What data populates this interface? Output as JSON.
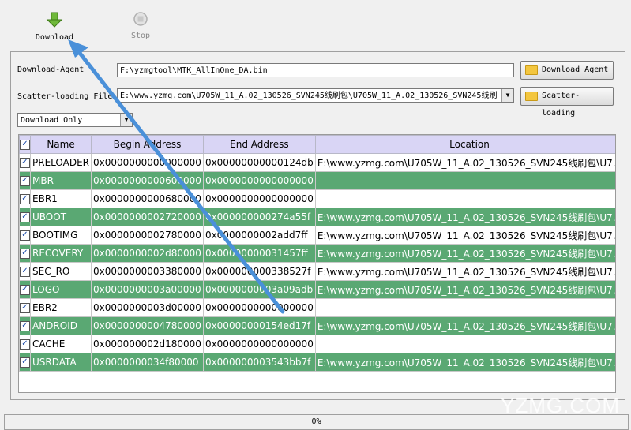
{
  "toolbar": {
    "download_label": "Download",
    "stop_label": "Stop"
  },
  "form": {
    "download_agent_label": "Download-Agent",
    "download_agent_value": "F:\\yzmgtool\\MTK_AllInOne_DA.bin",
    "download_agent_button": "Download Agent",
    "scatter_label": "Scatter-loading File",
    "scatter_value": "E:\\www.yzmg.com\\U705W_11_A.02_130526_SVN245线刷包\\U705W_11_A.02_130526_SVN245线刷",
    "scatter_button": "Scatter-loading",
    "mode_value": "Download Only"
  },
  "table": {
    "headers": [
      "Name",
      "Begin Address",
      "End Address",
      "Location"
    ],
    "rows": [
      {
        "name": "PRELOADER",
        "begin": "0x0000000000000000",
        "end": "0x00000000000124db",
        "location": "E:\\www.yzmg.com\\U705W_11_A.02_130526_SVN245线刷包\\U7..."
      },
      {
        "name": "MBR",
        "begin": "0x0000000000600000",
        "end": "0x0000000000000000",
        "location": ""
      },
      {
        "name": "EBR1",
        "begin": "0x0000000000680000",
        "end": "0x0000000000000000",
        "location": ""
      },
      {
        "name": "UBOOT",
        "begin": "0x0000000002720000",
        "end": "0x000000000274a55f",
        "location": "E:\\www.yzmg.com\\U705W_11_A.02_130526_SVN245线刷包\\U7..."
      },
      {
        "name": "BOOTIMG",
        "begin": "0x0000000002780000",
        "end": "0x0000000002add7ff",
        "location": "E:\\www.yzmg.com\\U705W_11_A.02_130526_SVN245线刷包\\U7..."
      },
      {
        "name": "RECOVERY",
        "begin": "0x0000000002d80000",
        "end": "0x00000000031457ff",
        "location": "E:\\www.yzmg.com\\U705W_11_A.02_130526_SVN245线刷包\\U7..."
      },
      {
        "name": "SEC_RO",
        "begin": "0x0000000003380000",
        "end": "0x000000000338527f",
        "location": "E:\\www.yzmg.com\\U705W_11_A.02_130526_SVN245线刷包\\U7..."
      },
      {
        "name": "LOGO",
        "begin": "0x0000000003a00000",
        "end": "0x0000000003a09adb",
        "location": "E:\\www.yzmg.com\\U705W_11_A.02_130526_SVN245线刷包\\U7..."
      },
      {
        "name": "EBR2",
        "begin": "0x0000000003d00000",
        "end": "0x0000000000000000",
        "location": ""
      },
      {
        "name": "ANDROID",
        "begin": "0x0000000004780000",
        "end": "0x00000000154ed17f",
        "location": "E:\\www.yzmg.com\\U705W_11_A.02_130526_SVN245线刷包\\U7..."
      },
      {
        "name": "CACHE",
        "begin": "0x000000002d180000",
        "end": "0x0000000000000000",
        "location": ""
      },
      {
        "name": "USRDATA",
        "begin": "0x0000000034f80000",
        "end": "0x000000003543bb7f",
        "location": "E:\\www.yzmg.com\\U705W_11_A.02_130526_SVN245线刷包\\U7..."
      }
    ]
  },
  "status": {
    "progress_text": "0%",
    "progress": 0
  },
  "watermark": "YZMG.COM",
  "colors": {
    "header_bg": "#d9d5f5",
    "alt_row_bg": "#5aa873",
    "arrow": "#4a90d9"
  },
  "icons": {
    "download": "down-arrow-icon",
    "stop": "stop-icon",
    "folder": "folder-icon"
  }
}
